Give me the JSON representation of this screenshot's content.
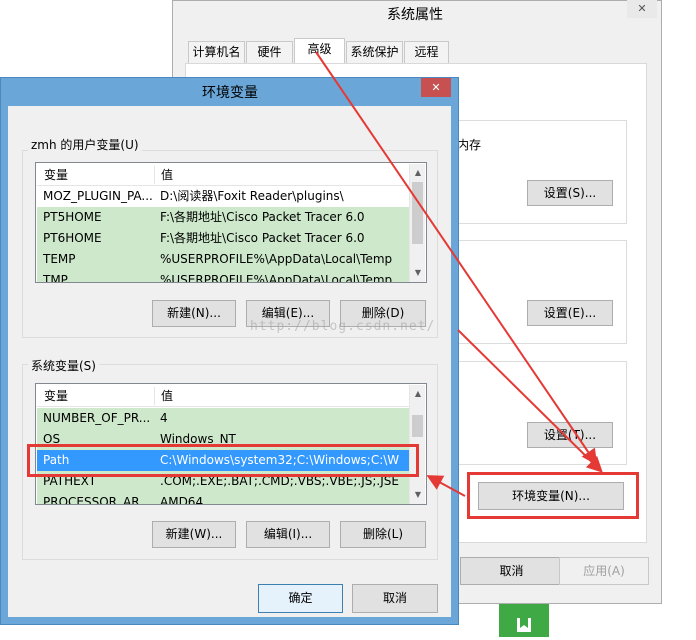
{
  "back_dialog": {
    "title": "系统属性",
    "tabs": [
      "计算机名",
      "硬件",
      "高级",
      "系统保护",
      "远程"
    ],
    "active_tab_index": 2,
    "partial_text": "内存",
    "settings_buttons": [
      "设置(S)...",
      "设置(E)...",
      "设置(T)..."
    ],
    "env_button": "环境变量(N)...",
    "ok_button": "",
    "cancel_button": "取消",
    "apply_button": "应用(A)"
  },
  "env_dialog": {
    "title": "环境变量",
    "user_group_label": "zmh 的用户变量(U)",
    "sys_group_label": "系统变量(S)",
    "col_variable": "变量",
    "col_value": "值",
    "user_rows": [
      {
        "var": "MOZ_PLUGIN_PA...",
        "value": "D:\\阅读器\\Foxit Reader\\plugins\\"
      },
      {
        "var": "PT5HOME",
        "value": "F:\\各期地址\\Cisco Packet Tracer 6.0"
      },
      {
        "var": "PT6HOME",
        "value": "F:\\各期地址\\Cisco Packet Tracer 6.0"
      },
      {
        "var": "TEMP",
        "value": "%USERPROFILE%\\AppData\\Local\\Temp"
      },
      {
        "var": "TMP",
        "value": "%USERPROFILE%\\AppData\\Local\\Temp"
      }
    ],
    "sys_rows": [
      {
        "var": "NUMBER_OF_PR...",
        "value": "4"
      },
      {
        "var": "OS",
        "value": "Windows_NT"
      },
      {
        "var": "Path",
        "value": "C:\\Windows\\system32;C:\\Windows;C:\\Wi..."
      },
      {
        "var": "PATHEXT",
        "value": ".COM;.EXE;.BAT;.CMD;.VBS;.VBE;.JS;.JSE;..."
      },
      {
        "var": "PROCESSOR_AR...",
        "value": "AMD64"
      }
    ],
    "user_buttons": {
      "new": "新建(N)...",
      "edit": "编辑(E)...",
      "delete": "删除(D)"
    },
    "sys_buttons": {
      "new": "新建(W)...",
      "edit": "编辑(I)...",
      "delete": "删除(L)"
    },
    "ok_button": "确定",
    "cancel_button": "取消",
    "close_glyph": "✕"
  },
  "watermark": "http://blog.csdn.net/",
  "colors": {
    "dialog_frame": "#6aa7d8",
    "selected_row": "#cde8ca",
    "highlight_row": "#3399ff",
    "close_button": "#c75050",
    "annotation_red": "#e53935",
    "taskbar_tile": "#3fa945"
  },
  "icons": [
    "close-icon",
    "scroll-up-icon",
    "scroll-down-icon",
    "bookmark-icon",
    "arrow-annotation"
  ]
}
